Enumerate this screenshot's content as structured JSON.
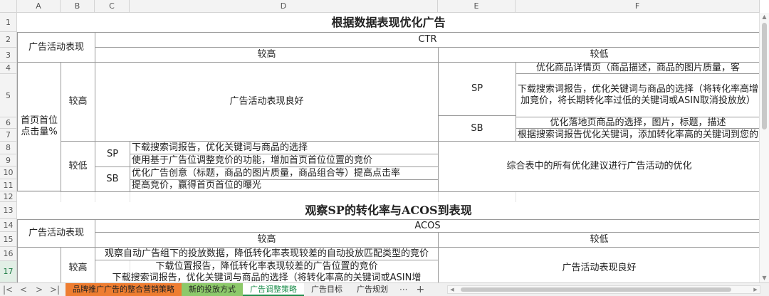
{
  "columns": [
    "A",
    "B",
    "C",
    "D",
    "E",
    "F"
  ],
  "rows": [
    "1",
    "2",
    "3",
    "4",
    "5",
    "6",
    "7",
    "8",
    "9",
    "10",
    "11",
    "12",
    "13",
    "14",
    "15",
    "16",
    "17"
  ],
  "active_row": "17",
  "table1": {
    "title": "根据数据表现优化广告",
    "row_header": "广告活动表现",
    "metric": "CTR",
    "high": "较高",
    "low": "较低",
    "side_metric": "首页首位点击量%",
    "sp": "SP",
    "sb": "SB",
    "good": "广告活动表现良好",
    "f4": "优化商品详情页（商品描述，商品的图片质量，客",
    "f5": "下载搜索词报告，优化关键词与商品的选择（将转化率高增加竞价，将长期转化率过低的关键词或ASIN取消投放放）",
    "f6": "优化落地页商品的选择，图片，标题，描述",
    "f7": "根据搜索词报告优化关键词，添加转化率高的关键词到您的",
    "d8": "下载搜索词报告，优化关键词与商品的选择",
    "d9": "使用基于广告位调整竞价的功能，增加首页首位位置的竞价",
    "d10": "优化广告创意（标题，商品的图片质量，商品组合等）提高点击率",
    "d11": "提高竞价，赢得首页首位的曝光",
    "combined": "综合表中的所有优化建议进行广告活动的优化"
  },
  "table2": {
    "title": "观察SP的转化率与ACOS到表现",
    "row_header": "广告活动表现",
    "metric": "ACOS",
    "high": "较高",
    "low": "较低",
    "d16": "观察自动广告组下的投放数据，降低转化率表现较差的自动投放匹配类型的竞价",
    "d17": "下载位置报告，降低转化率表现较差的广告位置的竞价",
    "d18": "下载搜索词报告，优化关键词与商品的选择（将转化率高的关键词或ASIN增",
    "good": "广告活动表现良好"
  },
  "tabs": [
    {
      "label": "品牌推广广告的整合营销策略",
      "style": "orange"
    },
    {
      "label": "新的投放方式",
      "style": "green"
    },
    {
      "label": "广告调整策略",
      "style": "active"
    },
    {
      "label": "广告目标",
      "style": "plain"
    },
    {
      "label": "广告规划",
      "style": "plain"
    }
  ],
  "more_label": "···",
  "add_label": "+",
  "nav": {
    "first": "|<",
    "prev": "<",
    "next": ">",
    "last": ">|"
  }
}
